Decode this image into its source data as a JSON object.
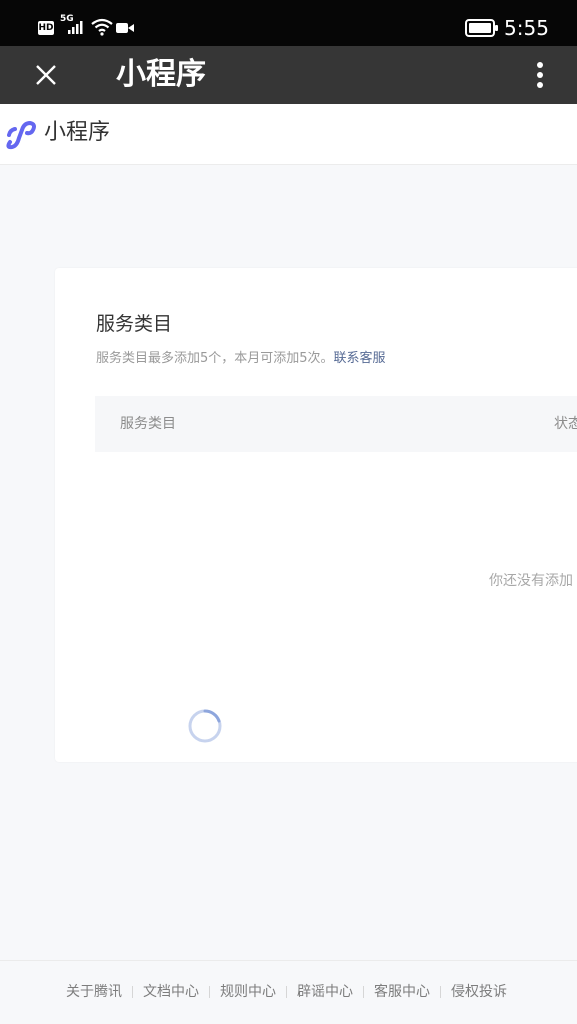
{
  "status_bar": {
    "hd": "HD",
    "network": "5G",
    "time": "5:55"
  },
  "title_bar": {
    "title": "小程序",
    "close_icon": "close-icon",
    "more_icon": "more-vertical-icon"
  },
  "page_header": {
    "title": "小程序",
    "logo_icon": "miniprogram-logo-icon",
    "logo_color": "#6467f0"
  },
  "card": {
    "title": "服务类目",
    "description": "服务类目最多添加5个，本月可添加5次。",
    "contact_link": "联系客服",
    "link_color": "#576b95",
    "table": {
      "columns": [
        "服务类目",
        "状态"
      ]
    },
    "empty_text": "你还没有添加"
  },
  "footer": {
    "links": [
      "关于腾讯",
      "文档中心",
      "规则中心",
      "辟谣中心",
      "客服中心",
      "侵权投诉"
    ]
  }
}
